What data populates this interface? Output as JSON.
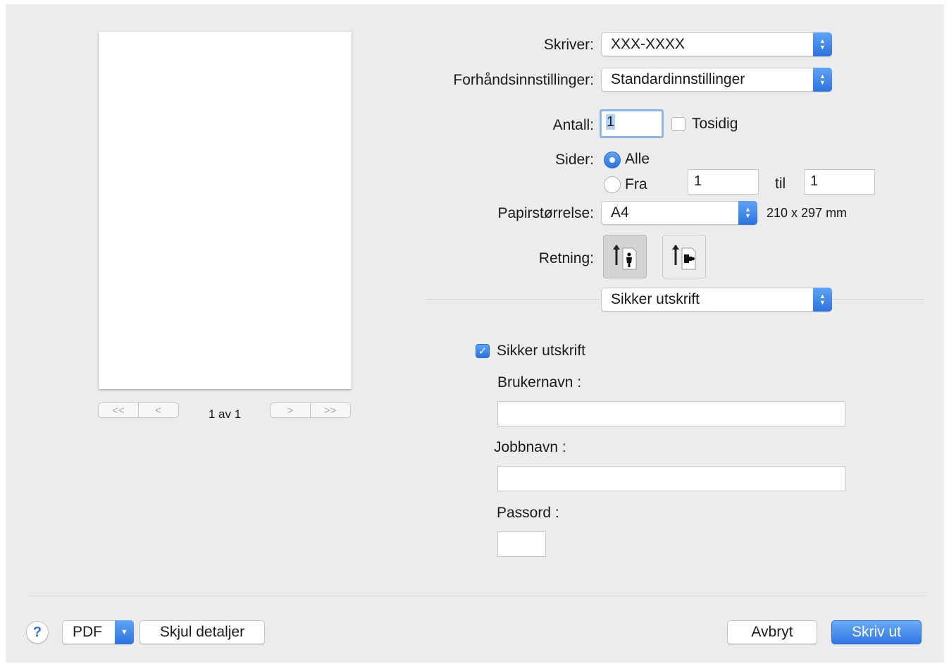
{
  "preview": {
    "page_indicator": "1 av 1",
    "nav_first": "<<",
    "nav_prev": "<",
    "nav_next": ">",
    "nav_last": ">>"
  },
  "printer": {
    "label": "Skriver:",
    "value": "XXX-XXXX"
  },
  "presets": {
    "label": "Forhåndsinnstillinger:",
    "value": "Standardinnstillinger"
  },
  "copies": {
    "label": "Antall:",
    "value": "1",
    "duplex_label": "Tosidig",
    "duplex_checked": false
  },
  "pages": {
    "label": "Sider:",
    "all_label": "Alle",
    "all_selected": true,
    "range_label": "Fra",
    "from_value": "1",
    "to_label": "til",
    "to_value": "1"
  },
  "paper_size": {
    "label": "Papirstørrelse:",
    "value": "A4",
    "dimensions": "210 x 297 mm"
  },
  "orientation": {
    "label": "Retning:",
    "selected": "portrait"
  },
  "section_popup": {
    "value": "Sikker utskrift"
  },
  "secure_print": {
    "checkbox_label": "Sikker utskrift",
    "checked": true,
    "username_label": "Brukernavn :",
    "username_value": "",
    "jobname_label": "Jobbnavn :",
    "jobname_value": "",
    "password_label": "Passord :",
    "password_value": ""
  },
  "footer": {
    "help": "?",
    "pdf_label": "PDF",
    "hide_details_label": "Skjul detaljer",
    "cancel_label": "Avbryt",
    "print_label": "Skriv ut"
  },
  "colors": {
    "accent": "#2f77e3",
    "background": "#ececec"
  },
  "icons": [
    "chevron-updown-icon",
    "portrait-orientation-icon",
    "landscape-orientation-icon",
    "checkmark-icon",
    "help-icon",
    "chevron-down-icon"
  ]
}
